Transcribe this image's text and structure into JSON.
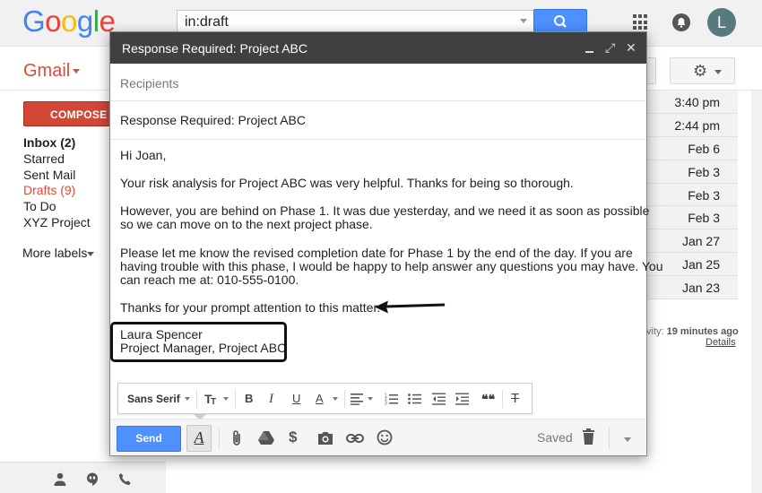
{
  "header": {
    "logo_text": "Google",
    "search_value": "in:draft",
    "avatar_letter": "L"
  },
  "sidebar": {
    "app_label": "Gmail",
    "compose_label": "COMPOSE",
    "items": [
      {
        "label": "Inbox (2)"
      },
      {
        "label": "Starred"
      },
      {
        "label": "Sent Mail"
      },
      {
        "label": "Drafts (9)"
      },
      {
        "label": "To Do"
      },
      {
        "label": "XYZ Project"
      }
    ],
    "more_labels": "More labels"
  },
  "list": {
    "dates": [
      "3:40 pm",
      "2:44 pm",
      "Feb 6",
      "Feb 3",
      "Feb 3",
      "Feb 3",
      "Jan 27",
      "Jan 25",
      "Jan 23"
    ],
    "activity_prefix": "vity: ",
    "activity_time": "19 minutes ago",
    "details_link": "Details"
  },
  "compose": {
    "title": "Response Required: Project ABC",
    "recipients_placeholder": "Recipients",
    "subject": "Response Required: Project ABC",
    "body": {
      "greeting": "Hi Joan,",
      "para1": "Your risk analysis for Project ABC was very helpful. Thanks for being so thorough.",
      "para2_l1": "However, you are behind on Phase 1. It was due yesterday, and we need it as soon as possible",
      "para2_l2": "so we can move on to the next project phase.",
      "para3_l1": "Please let me know the revised completion date for Phase 1 by the end of the day. If you are",
      "para3_l2": "having trouble with this phase, I would be happy to help answer any questions you may have. You",
      "para3_l3": "can reach me at: 010-555-0100.",
      "closing": "Thanks for your prompt attention to this matter.",
      "sig_name": "Laura Spencer",
      "sig_title": "Project Manager, Project ABC"
    },
    "formatting": {
      "font_name": "Sans Serif",
      "size_glyph": "T",
      "bold_glyph": "B",
      "italic_glyph": "I",
      "underline_glyph": "U",
      "text_color_glyph": "A",
      "quote_glyph": "❝❝",
      "remove_format_glyph": "T"
    },
    "send_label": "Send",
    "format_toggle_glyph": "A",
    "dollar_glyph": "$",
    "saved_label": "Saved"
  },
  "colors": {
    "accent_blue": "#4d90fe",
    "compose_red": "#d14836",
    "title_bar": "#404040"
  }
}
